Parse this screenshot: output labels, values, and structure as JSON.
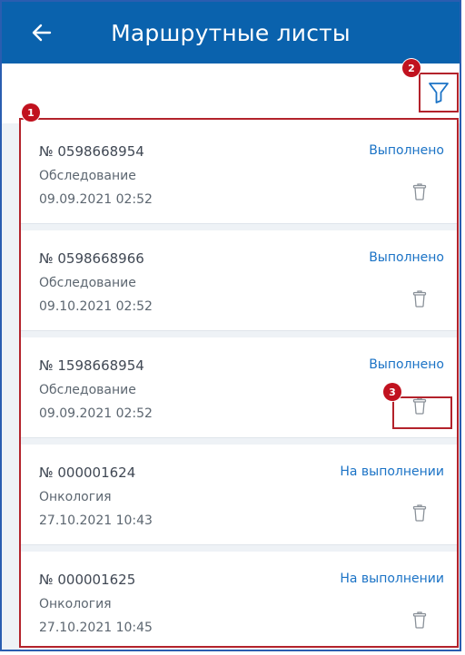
{
  "header": {
    "title": "Маршрутные листы",
    "back_icon": "arrow-left-icon"
  },
  "toolbar": {
    "filter_icon": "filter-icon"
  },
  "annotations": {
    "list": "1",
    "filter": "2",
    "delete": "3"
  },
  "colors": {
    "appbar": "#0a62ad",
    "status": "#1b73c6",
    "annotation": "#b3222b"
  },
  "routes": [
    {
      "number": "№ 0598668954",
      "type": "Обследование",
      "date": "09.09.2021 02:52",
      "status": "Выполнено"
    },
    {
      "number": "№ 0598668966",
      "type": "Обследование",
      "date": "09.10.2021 02:52",
      "status": "Выполнено"
    },
    {
      "number": "№ 1598668954",
      "type": "Обследование",
      "date": "09.09.2021 02:52",
      "status": "Выполнено"
    },
    {
      "number": "№ 000001624",
      "type": "Онкология",
      "date": "27.10.2021 10:43",
      "status": "На выполнении"
    },
    {
      "number": "№ 000001625",
      "type": "Онкология",
      "date": "27.10.2021 10:45",
      "status": "На выполнении"
    }
  ]
}
